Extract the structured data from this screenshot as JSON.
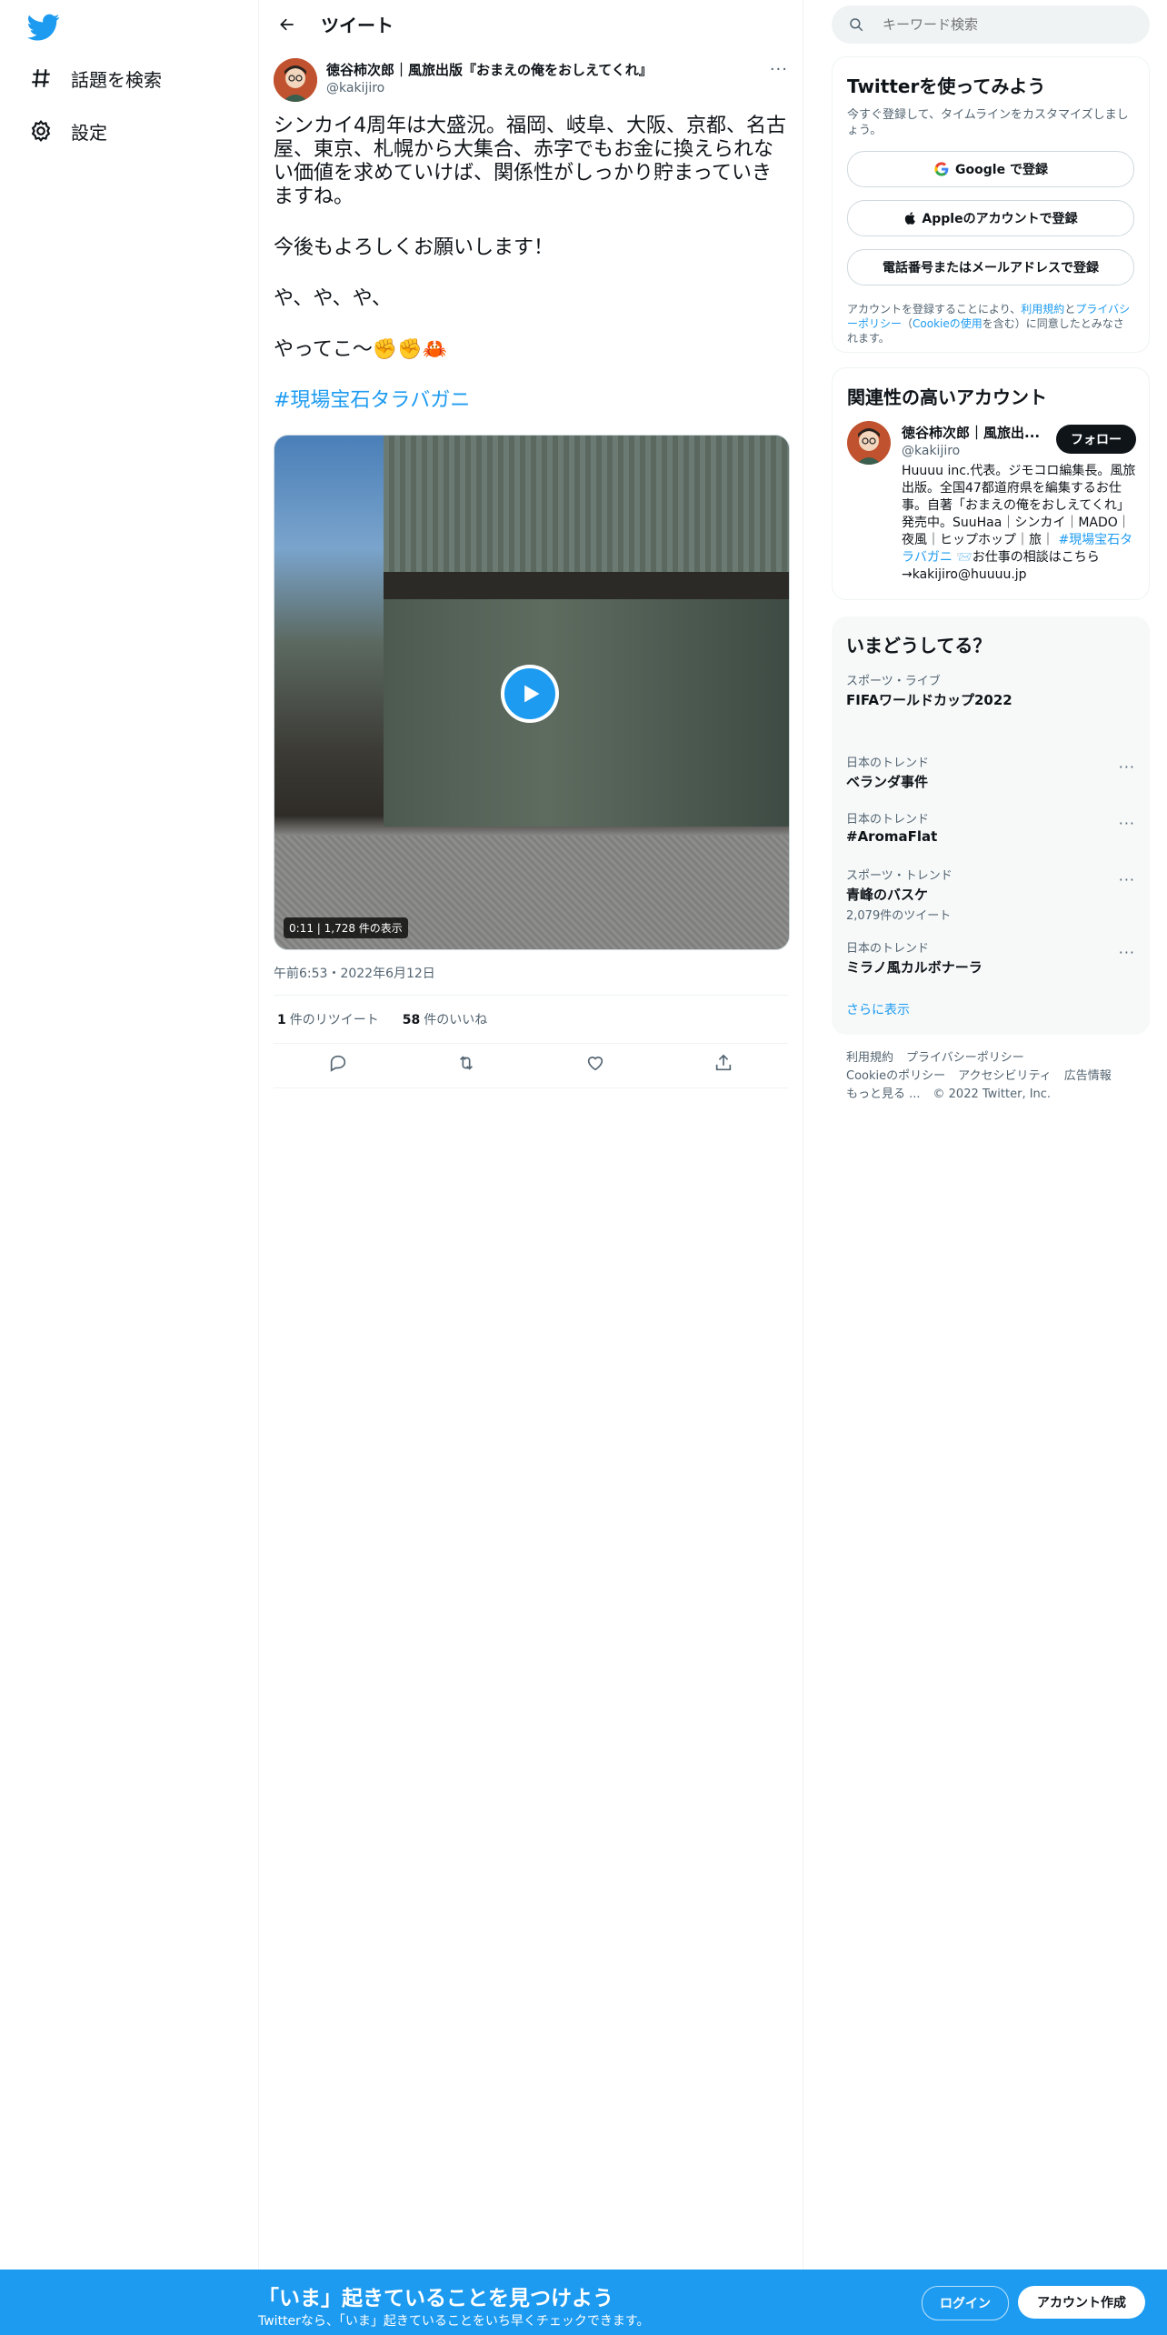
{
  "nav": {
    "explore": "話題を検索",
    "settings": "設定"
  },
  "header": {
    "title": "ツイート"
  },
  "tweet": {
    "author_name": "徳谷柿次郎｜風旅出版『おまえの俺をおしえてくれ』",
    "author_handle": "@kakijiro",
    "para1": "シンカイ4周年は大盛況。福岡、岐阜、大阪、京都、名古屋、東京、札幌から大集合、赤字でもお金に換えられない価値を求めていけば、関係性がしっかり貯まっていきますね。",
    "para2": "今後もよろしくお願いします！",
    "para3": "や、や、や、",
    "para4": "やってこ〜✊✊🦀",
    "hashtag": "#現場宝石タラバガニ",
    "video_duration": "0:11",
    "video_views": "1,728 件の表示",
    "timestamp": "午前6:53・2022年6月12日",
    "retweets_count": "1",
    "retweets_label": "件のリツイート",
    "likes_count": "58",
    "likes_label": "件のいいね"
  },
  "search": {
    "placeholder": "キーワード検索"
  },
  "signup_card": {
    "title": "Twitterを使ってみよう",
    "subtitle": "今すぐ登録して、タイムラインをカスタマイズしましょう。",
    "google_button": "Google で登録",
    "apple_button": "Appleのアカウントで登録",
    "phone_button": "電話番号またはメールアドレスで登録",
    "terms_prefix": "アカウントを登録することにより、",
    "terms_link": "利用規約",
    "terms_and": "と",
    "privacy_link": "プライバシーポリシー",
    "cookie_open": "（",
    "cookie_link": "Cookieの使用",
    "terms_suffix": "を含む）に同意したとみなされます。"
  },
  "related": {
    "title": "関連性の高いアカウント",
    "name": "徳谷柿次郎｜風旅出...",
    "handle": "@kakijiro",
    "follow": "フォロー",
    "bio": "Huuuu inc.代表。ジモコロ編集長。風旅出版。全国47都道府県を編集するお仕事。自著「おまえの俺をおしえてくれ」発売中。SuuHaa｜シンカイ｜MADO｜夜風｜ヒップホップ｜旅｜",
    "bio_tag": "#現場宝石タラバガニ",
    "bio_end": "📨お仕事の相談はこちら→kakijiro@huuuu.jp"
  },
  "trends": {
    "title": "いまどうしてる？",
    "items": [
      {
        "category": "スポーツ・ライブ",
        "name": "FIFAワールドカップ2022",
        "count": ""
      },
      {
        "category": "日本のトレンド",
        "name": "ベランダ事件",
        "count": ""
      },
      {
        "category": "日本のトレンド",
        "name": "#AromaFlat",
        "count": ""
      },
      {
        "category": "スポーツ・トレンド",
        "name": "青峰のバスケ",
        "count": "2,079件のツイート"
      },
      {
        "category": "日本のトレンド",
        "name": "ミラノ風カルボナーラ",
        "count": ""
      }
    ],
    "show_more": "さらに表示"
  },
  "footer": {
    "terms": "利用規約",
    "privacy": "プライバシーポリシー",
    "cookie": "Cookieのポリシー",
    "accessibility": "アクセシビリティ",
    "ads": "広告情報",
    "more": "もっと見る ...",
    "copyright": "© 2022 Twitter, Inc."
  },
  "bottom_bar": {
    "title": "「いま」起きていることを見つけよう",
    "subtitle": "Twitterなら、「いま」起きていることをいち早くチェックできます。",
    "login": "ログイン",
    "signup": "アカウント作成"
  },
  "colors": {
    "accent": "#1d9bf0",
    "text": "#0f1419",
    "muted": "#536471"
  }
}
